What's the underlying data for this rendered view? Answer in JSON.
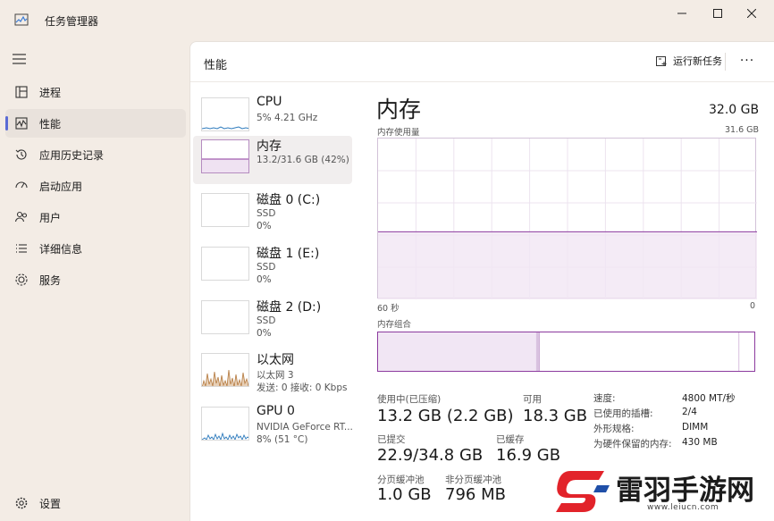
{
  "window": {
    "title": "任务管理器",
    "controls": {
      "minimize": "—",
      "maximize": "☐",
      "close": "✕"
    }
  },
  "sidebar": {
    "items": [
      {
        "label": "进程",
        "icon": "processes-icon"
      },
      {
        "label": "性能",
        "icon": "performance-icon",
        "active": true
      },
      {
        "label": "应用历史记录",
        "icon": "app-history-icon"
      },
      {
        "label": "启动应用",
        "icon": "startup-icon"
      },
      {
        "label": "用户",
        "icon": "users-icon"
      },
      {
        "label": "详细信息",
        "icon": "details-icon"
      },
      {
        "label": "服务",
        "icon": "services-icon"
      }
    ],
    "settings": "设置"
  },
  "header": {
    "title": "性能",
    "run_new_task": "运行新任务",
    "more": "···"
  },
  "devices": [
    {
      "name": "CPU",
      "line2": "5%  4.21 GHz",
      "line3": ""
    },
    {
      "name": "内存",
      "line2": "13.2/31.6 GB (42%)",
      "line3": "",
      "active": true
    },
    {
      "name": "磁盘 0 (C:)",
      "line2": "SSD",
      "line3": "0%"
    },
    {
      "name": "磁盘 1 (E:)",
      "line2": "SSD",
      "line3": "0%"
    },
    {
      "name": "磁盘 2 (D:)",
      "line2": "SSD",
      "line3": "0%"
    },
    {
      "name": "以太网",
      "line2": "以太网 3",
      "line3": "发送: 0 接收: 0 Kbps"
    },
    {
      "name": "GPU 0",
      "line2": "NVIDIA GeForce RT...",
      "line3": "8% (51 °C)"
    }
  ],
  "detail": {
    "title": "内存",
    "total": "32.0 GB",
    "usage_label": "内存使用量",
    "usage_max": "31.6 GB",
    "time_left": "60 秒",
    "time_right": "0",
    "composition_label": "内存组合",
    "usage_fraction": 0.42,
    "composition": {
      "in_use": 0.42,
      "modified": 0.01,
      "standby": 0.53,
      "free": 0.04
    },
    "stats": {
      "in_use_label": "使用中(已压缩)",
      "in_use_value": "13.2 GB (2.2 GB)",
      "available_label": "可用",
      "available_value": "18.3 GB",
      "committed_label": "已提交",
      "committed_value": "22.9/34.8 GB",
      "cached_label": "已缓存",
      "cached_value": "16.9 GB",
      "paged_label": "分页缓冲池",
      "paged_value": "1.0 GB",
      "nonpaged_label": "非分页缓冲池",
      "nonpaged_value": "796 MB"
    },
    "specs": [
      {
        "label": "速度:",
        "value": "4800 MT/秒"
      },
      {
        "label": "已使用的插槽:",
        "value": "2/4"
      },
      {
        "label": "外形规格:",
        "value": "DIMM"
      },
      {
        "label": "为硬件保留的内存:",
        "value": "430 MB"
      }
    ]
  },
  "colors": {
    "accent": "#5a6bd5",
    "memory_line": "#8c3a9e",
    "memory_fill": "#f1e6f4",
    "grid": "#ece3ef"
  },
  "watermark": {
    "text": "雷羽手游网",
    "url": "www.leiucn.com"
  }
}
